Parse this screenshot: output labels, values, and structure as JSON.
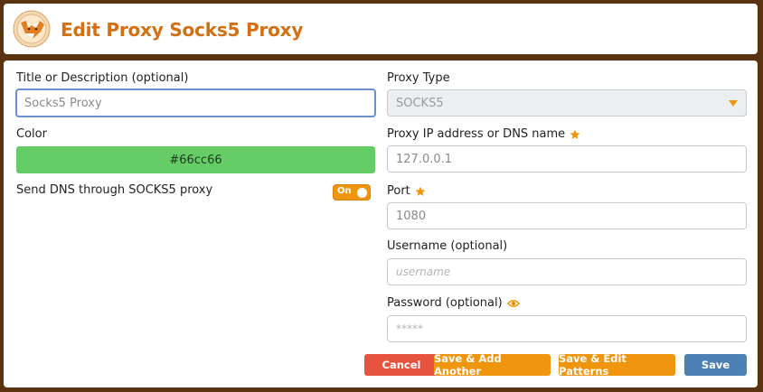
{
  "header": {
    "title": "Edit Proxy Socks5 Proxy",
    "logo_icon": "foxyproxy-fox-icon"
  },
  "form": {
    "title_label": "Title or Description (optional)",
    "title_value": "Socks5 Proxy",
    "color_label": "Color",
    "color_value": "#66cc66",
    "dns_label": "Send DNS through SOCKS5 proxy",
    "dns_toggle_label": "On",
    "proxy_type_label": "Proxy Type",
    "proxy_type_value": "SOCKS5",
    "ip_label": "Proxy IP address or DNS name",
    "ip_value": "127.0.0.1",
    "port_label": "Port",
    "port_value": "1080",
    "username_label": "Username (optional)",
    "username_placeholder": "username",
    "password_label": "Password (optional)",
    "password_placeholder": "*****"
  },
  "buttons": {
    "cancel": "Cancel",
    "save_add_another": "Save & Add Another",
    "save_edit_patterns": "Save & Edit Patterns",
    "save": "Save"
  },
  "colors": {
    "accent": "#f0960e",
    "title": "#d46f12",
    "cancel": "#e8533f",
    "save": "#4d80b5",
    "proxy_color": "#66cc66",
    "background": "#5a3310"
  }
}
